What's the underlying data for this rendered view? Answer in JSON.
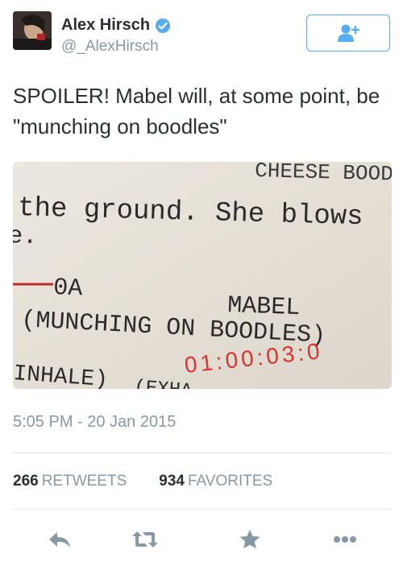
{
  "user": {
    "name": "Alex Hirsch",
    "handle": "@_AlexHirsch",
    "verified": true
  },
  "follow_button": {
    "icon": "add-user-icon"
  },
  "tweet": {
    "text": "SPOILER! Mabel will, at some point, be \"munching on boodles\"",
    "timestamp": "5:05 PM - 20 Jan 2015"
  },
  "media": {
    "script_lines": [
      "CHEESE BOODLE",
      "the ground. She blows",
      "e.",
      "0A",
      "MABEL",
      "(MUNCHING ON BOODLES)",
      "01:00:03:0",
      "INHALE)",
      "(EXHA"
    ]
  },
  "stats": {
    "retweets_count": "266",
    "retweets_label": "RETWEETS",
    "favorites_count": "934",
    "favorites_label": "FAVORITES"
  },
  "actions": {
    "reply_icon": "reply-icon",
    "retweet_icon": "retweet-icon",
    "favorite_icon": "star-icon",
    "more_icon": "more-icon"
  },
  "colors": {
    "accent": "#55acee",
    "text": "#292f33",
    "secondary": "#8899a6",
    "action_icon": "#8899a6",
    "paper": "#e9e4dc",
    "ink": "#2a2a2a",
    "red_ink": "#d8342c"
  }
}
